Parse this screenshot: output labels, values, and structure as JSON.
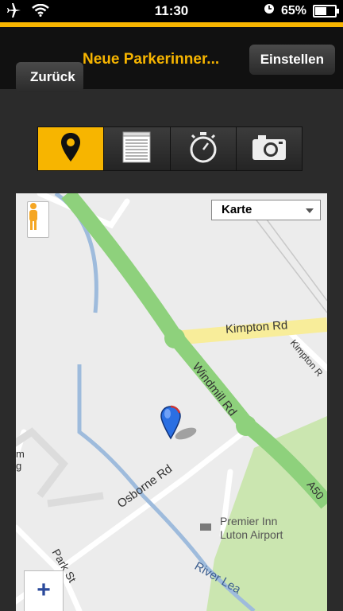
{
  "status_bar": {
    "time": "11:30",
    "battery_percent": "65%",
    "battery_level": 0.65,
    "icons": [
      "airplane-icon",
      "wifi-icon",
      "clock-icon",
      "battery-icon"
    ]
  },
  "nav": {
    "back_label": "Zurück",
    "title": "Neue Parkerinner...",
    "settings_label": "Einstellen",
    "accent_color": "#f7b500"
  },
  "segments": [
    {
      "icon": "location-pin-icon",
      "active": true
    },
    {
      "icon": "notepad-icon",
      "active": false
    },
    {
      "icon": "stopwatch-icon",
      "active": false
    },
    {
      "icon": "camera-icon",
      "active": false
    }
  ],
  "map": {
    "map_type_selected": "Karte",
    "zoom_in_label": "+",
    "labels": {
      "kimpton_rd": "Kimpton Rd",
      "kimpton_rd_side": "Kimpton R",
      "windmill_rd": "Windmill Rd",
      "a50": "A50",
      "osborne_rd": "Osborne Rd",
      "premier_inn_1": "Premier Inn",
      "premier_inn_2": "Luton Airport",
      "park_st": "Park St",
      "river_lea": "River Lea",
      "edge_m": "m",
      "edge_g": "g"
    }
  }
}
